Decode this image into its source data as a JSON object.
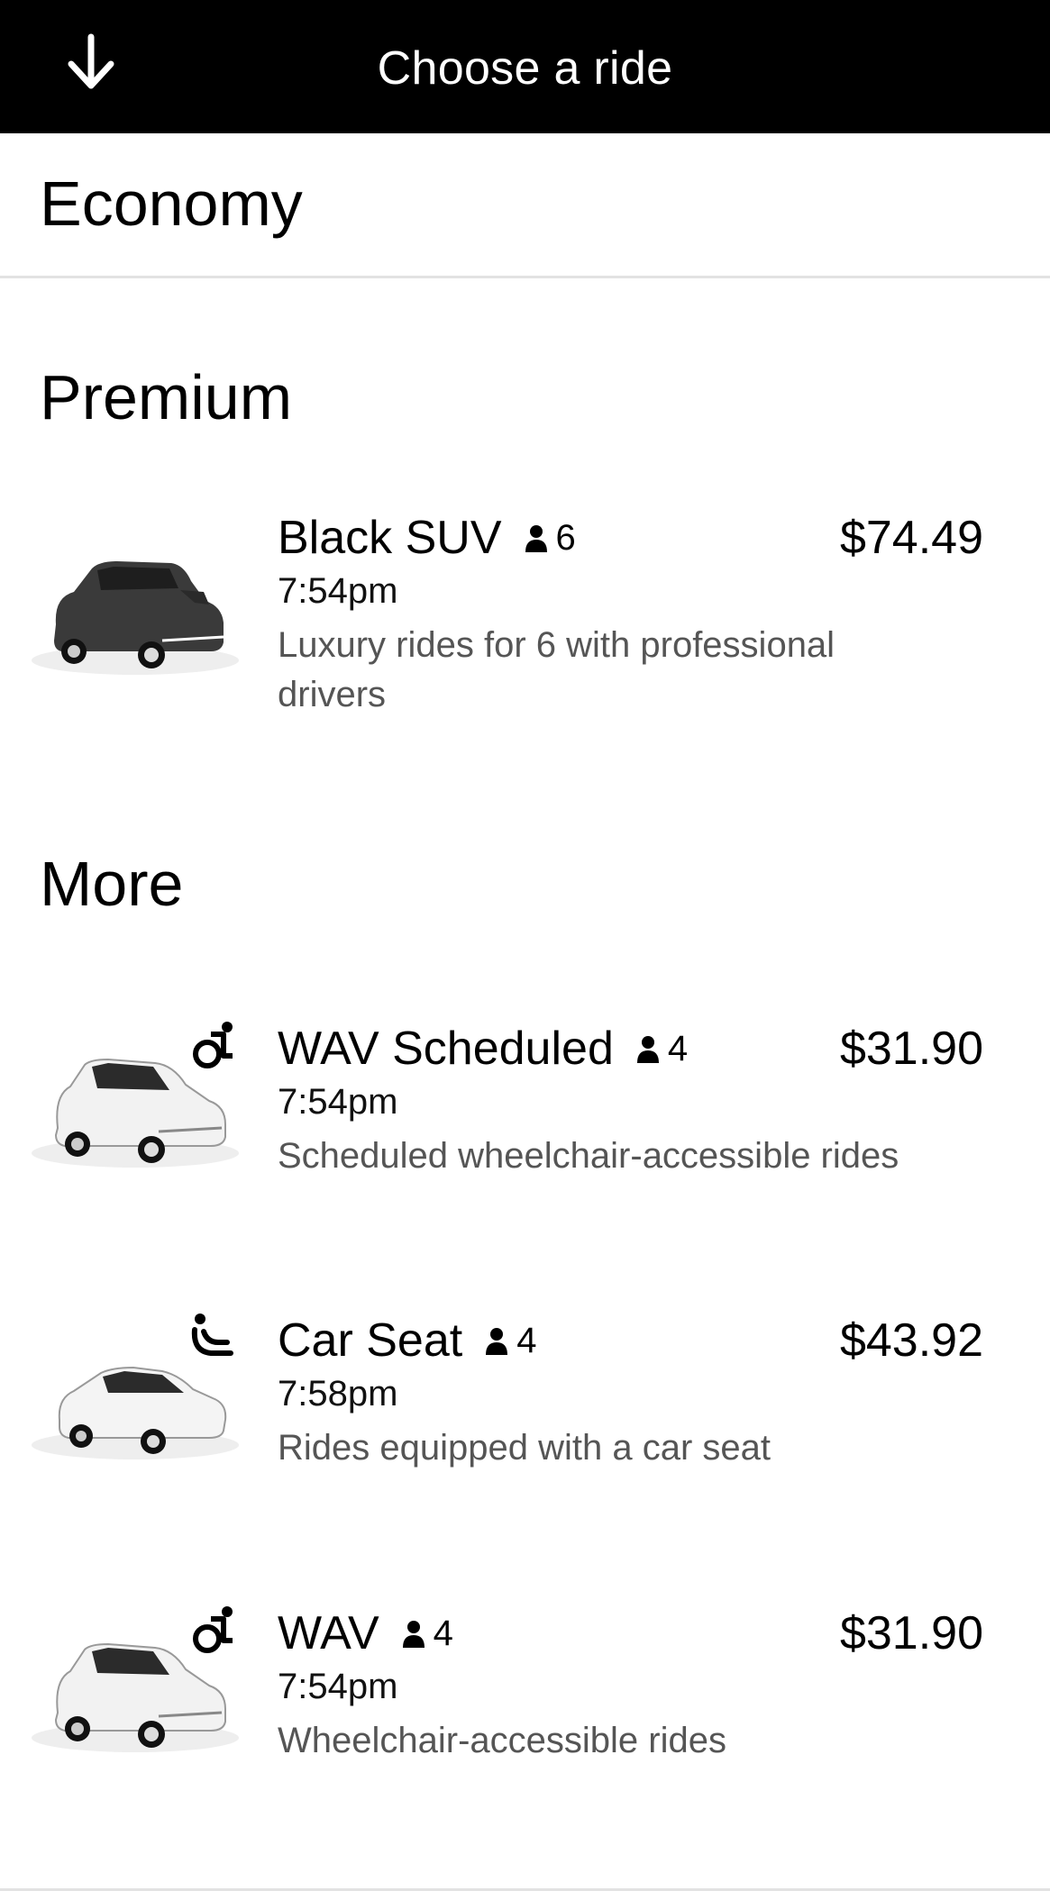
{
  "header": {
    "title": "Choose a ride",
    "back_icon": "arrow-down-icon"
  },
  "sections": {
    "economy": "Economy",
    "premium": "Premium",
    "more": "More"
  },
  "rides": [
    {
      "name": "Black SUV",
      "capacity": "6",
      "price": "$74.49",
      "eta": "7:54pm",
      "description": "Luxury rides for 6 with professional drivers",
      "car_color": "#3a3a3a",
      "feature_icon": ""
    },
    {
      "name": "WAV Scheduled",
      "capacity": "4",
      "price": "$31.90",
      "eta": "7:54pm",
      "description": "Scheduled wheelchair-accessible rides",
      "car_color": "#f2f2f2",
      "feature_icon": "wheelchair-icon"
    },
    {
      "name": "Car Seat",
      "capacity": "4",
      "price": "$43.92",
      "eta": "7:58pm",
      "description": "Rides equipped with a car seat",
      "car_color": "#f4f4f4",
      "feature_icon": "car-seat-icon"
    },
    {
      "name": "WAV",
      "capacity": "4",
      "price": "$31.90",
      "eta": "7:54pm",
      "description": "Wheelchair-accessible rides",
      "car_color": "#f2f2f2",
      "feature_icon": "wheelchair-icon"
    }
  ]
}
